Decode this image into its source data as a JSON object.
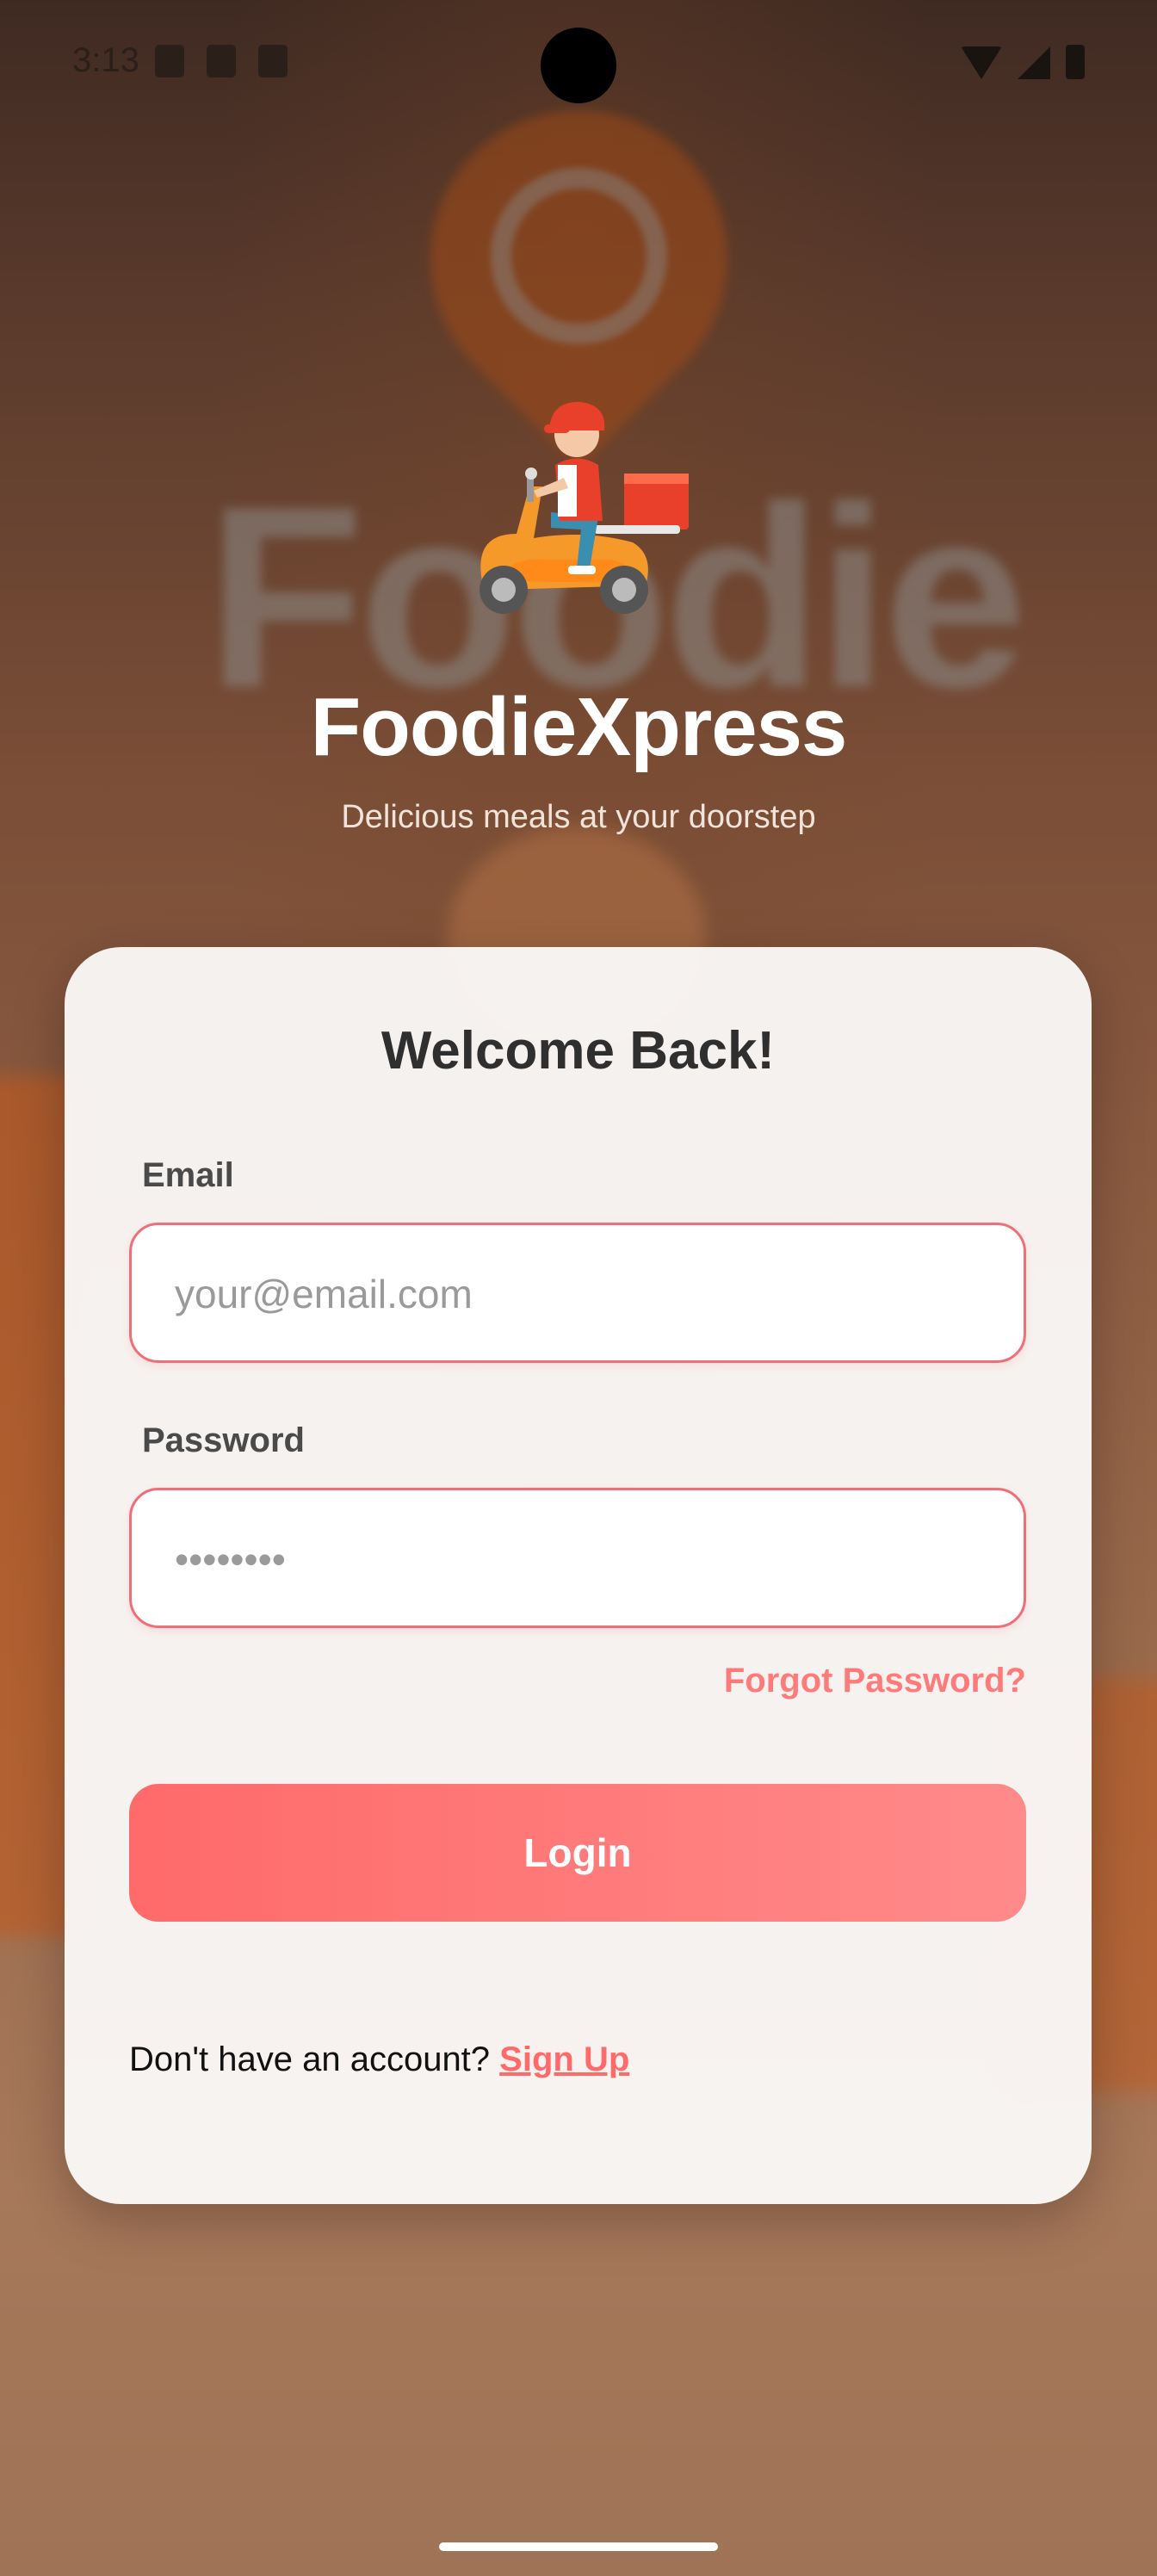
{
  "status_bar": {
    "time": "3:13",
    "left_icons": [
      "shield-icon",
      "font-icon",
      "sd-card-icon"
    ],
    "right_icons": [
      "wifi-icon",
      "signal-icon",
      "battery-icon"
    ]
  },
  "header": {
    "mascot": "delivery-scooter-icon",
    "title": "FoodieXpress",
    "subtitle": "Delicious meals at your doorstep"
  },
  "login_card": {
    "title": "Welcome Back!",
    "email": {
      "label": "Email",
      "placeholder": "your@email.com",
      "value": ""
    },
    "password": {
      "label": "Password",
      "placeholder": "••••••••",
      "value": ""
    },
    "forgot_password": "Forgot Password?",
    "login_button": "Login",
    "signup_prompt": "Don't have an account?",
    "signup_link": "Sign Up"
  },
  "colors": {
    "accent": "#ff6b6b",
    "field_border": "#ef6f79",
    "title_text": "#2f2f2f",
    "card_background": "#faf8f7"
  }
}
